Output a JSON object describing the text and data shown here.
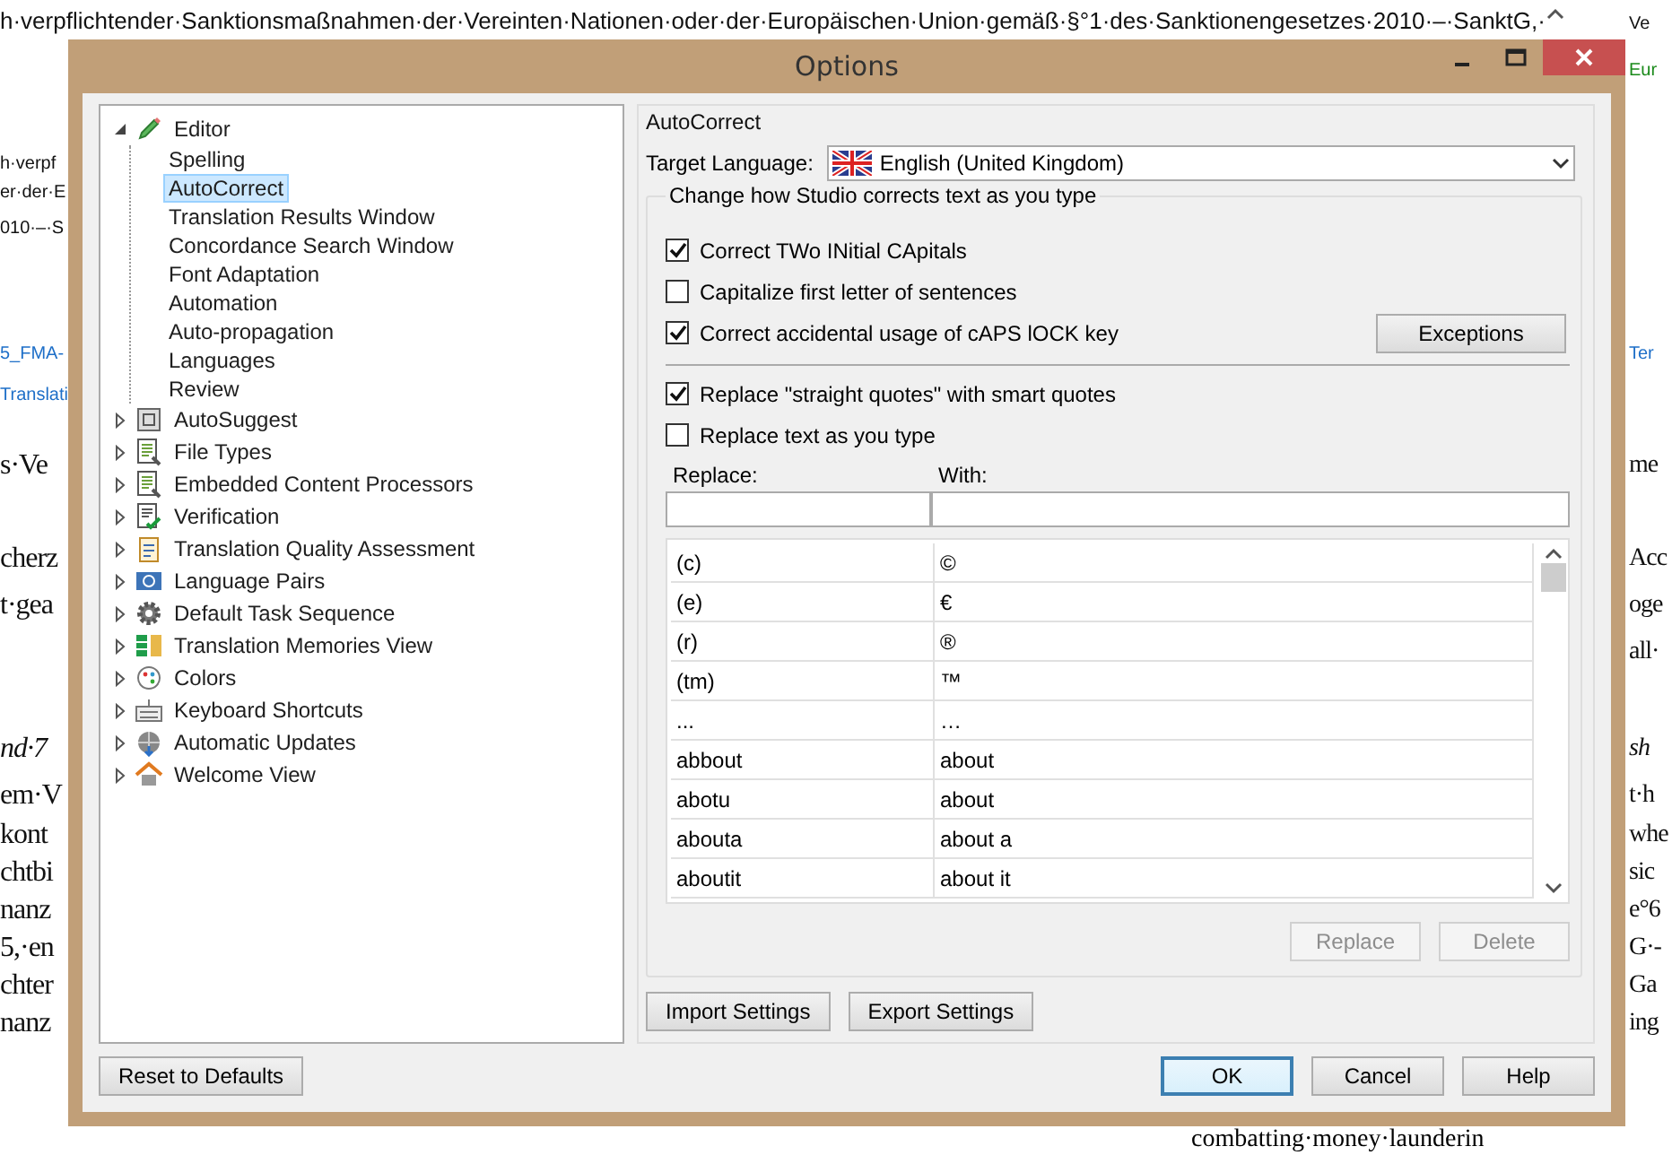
{
  "document": {
    "top_line": "h·verpflichtender·Sanktionsmaßnahmen·der·Vereinten·Nationen·oder·der·Europäischen·Union·gemäß·§°1·des·Sanktionengesetzes·2010·–·SanktG,·",
    "left_fragments": [
      {
        "text": "h·verpf",
        "kind": "small"
      },
      {
        "text": "er·der·E",
        "kind": "small"
      },
      {
        "text": "010·–·S",
        "kind": "small"
      },
      {
        "text": "5_FMA-",
        "kind": "link"
      },
      {
        "text": "Translati",
        "kind": "link"
      },
      {
        "text": "s·Ve",
        "kind": "serif"
      },
      {
        "text": "cherz",
        "kind": "serif"
      },
      {
        "text": "t·gea",
        "kind": "serif"
      },
      {
        "text": "nd·7",
        "kind": "italic"
      },
      {
        "text": "em·V",
        "kind": "serif"
      },
      {
        "text": "kont",
        "kind": "serif"
      },
      {
        "text": "chtbi",
        "kind": "serif"
      },
      {
        "text": "nanz",
        "kind": "serif"
      },
      {
        "text": "5,·en",
        "kind": "serif"
      },
      {
        "text": "chter",
        "kind": "serif"
      },
      {
        "text": "nanz",
        "kind": "serif"
      }
    ],
    "right_fragments": [
      {
        "text": "Ve",
        "kind": "small"
      },
      {
        "text": "Eur",
        "kind": "green"
      },
      {
        "text": "Ter",
        "kind": "link"
      },
      {
        "text": "me",
        "kind": "serif"
      },
      {
        "text": "Acc",
        "kind": "serif"
      },
      {
        "text": "oge",
        "kind": "serif"
      },
      {
        "text": "all·",
        "kind": "serif"
      },
      {
        "text": "sh",
        "kind": "italic"
      },
      {
        "text": "t·h",
        "kind": "serif"
      },
      {
        "text": "whe",
        "kind": "serif"
      },
      {
        "text": "sic",
        "kind": "serif"
      },
      {
        "text": "e°6",
        "kind": "serif"
      },
      {
        "text": "G·-",
        "kind": "serif"
      },
      {
        "text": "Ga",
        "kind": "serif"
      },
      {
        "text": "ing",
        "kind": "serif"
      }
    ],
    "bottom_line": "combatting·money·launderin"
  },
  "window": {
    "title": "Options"
  },
  "tree": [
    {
      "label": "Editor",
      "expanded": true,
      "selected": false,
      "children": [
        {
          "label": "Spelling",
          "selected": false
        },
        {
          "label": "AutoCorrect",
          "selected": true
        },
        {
          "label": "Translation Results Window",
          "selected": false
        },
        {
          "label": "Concordance Search Window",
          "selected": false
        },
        {
          "label": "Font Adaptation",
          "selected": false
        },
        {
          "label": "Automation",
          "selected": false
        },
        {
          "label": "Auto-propagation",
          "selected": false
        },
        {
          "label": "Languages",
          "selected": false
        },
        {
          "label": "Review",
          "selected": false
        }
      ]
    },
    {
      "label": "AutoSuggest",
      "expanded": false,
      "selected": false
    },
    {
      "label": "File Types",
      "expanded": false,
      "selected": false
    },
    {
      "label": "Embedded Content Processors",
      "expanded": false,
      "selected": false
    },
    {
      "label": "Verification",
      "expanded": false,
      "selected": false
    },
    {
      "label": "Translation Quality Assessment",
      "expanded": false,
      "selected": false
    },
    {
      "label": "Language Pairs",
      "expanded": false,
      "selected": false
    },
    {
      "label": "Default Task Sequence",
      "expanded": false,
      "selected": false
    },
    {
      "label": "Translation Memories View",
      "expanded": false,
      "selected": false
    },
    {
      "label": "Colors",
      "expanded": false,
      "selected": false
    },
    {
      "label": "Keyboard Shortcuts",
      "expanded": false,
      "selected": false
    },
    {
      "label": "Automatic Updates",
      "expanded": false,
      "selected": false
    },
    {
      "label": "Welcome View",
      "expanded": false,
      "selected": false
    }
  ],
  "autocorrect": {
    "title": "AutoCorrect",
    "target_language_label": "Target Language:",
    "target_language": "English (United Kingdom)",
    "group_title": "Change how Studio corrects text as you type",
    "options_1": [
      {
        "label": "Correct TWo INitial CApitals",
        "checked": true
      },
      {
        "label": "Capitalize first letter of sentences",
        "checked": false
      },
      {
        "label": "Correct accidental usage of cAPS lOCK key",
        "checked": true
      }
    ],
    "exceptions_button": "Exceptions",
    "options_2": [
      {
        "label": "Replace \"straight quotes\" with smart quotes",
        "checked": true
      },
      {
        "label": "Replace text as you type",
        "checked": false
      }
    ],
    "replace_label": "Replace:",
    "with_label": "With:",
    "rows": [
      {
        "replace": "(c)",
        "with": "©"
      },
      {
        "replace": "(e)",
        "with": "€"
      },
      {
        "replace": "(r)",
        "with": "®"
      },
      {
        "replace": "(tm)",
        "with": "™"
      },
      {
        "replace": "...",
        "with": "…"
      },
      {
        "replace": "abbout",
        "with": "about"
      },
      {
        "replace": "abotu",
        "with": "about"
      },
      {
        "replace": "abouta",
        "with": "about a"
      },
      {
        "replace": "aboutit",
        "with": "about it"
      }
    ],
    "row_buttons": [
      {
        "label": "Replace",
        "disabled": true
      },
      {
        "label": "Delete",
        "disabled": true
      }
    ],
    "settings_buttons": [
      "Import Settings",
      "Export Settings"
    ]
  },
  "reset_button": "Reset to Defaults",
  "dialog_buttons": [
    {
      "label": "OK",
      "default": true
    },
    {
      "label": "Cancel",
      "default": false
    },
    {
      "label": "Help",
      "default": false
    }
  ]
}
